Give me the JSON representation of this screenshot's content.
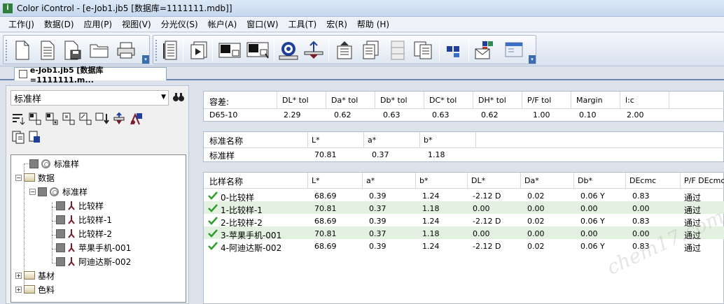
{
  "window": {
    "title": "Color iControl - [e-Job1.jb5 [数据库=1111111.mdb]]"
  },
  "menu": [
    "工作(J)",
    "数据(D)",
    "应用(P)",
    "视图(V)",
    "分光仪(S)",
    "帐户(A)",
    "窗口(W)",
    "工具(T)",
    "宏(R)",
    "帮助 (H)"
  ],
  "doc_tab": {
    "label": "e-Job1.jb5 [数据库=1111111.m..."
  },
  "left": {
    "combo_value": "标准样",
    "tree": {
      "std_root": "标准样",
      "data": "数据",
      "std_child": "标准样",
      "samples": [
        "比较样",
        "比较样-1",
        "比较样-2",
        "苹果手机-001",
        "阿迪达斯-002"
      ],
      "substrate": "基材",
      "colorant": "色料"
    }
  },
  "tolerance": {
    "headers": [
      "容差:",
      "DL* tol",
      "Da* tol",
      "Db* tol",
      "DC* tol",
      "DH* tol",
      "P/F tol",
      "Margin",
      "l:c"
    ],
    "row": [
      "D65-10",
      "2.29",
      "0.62",
      "0.63",
      "0.63",
      "0.62",
      "1.00",
      "0.10",
      "2.00"
    ]
  },
  "standard": {
    "headers": [
      "标准名称",
      "L*",
      "a*",
      "b*"
    ],
    "row": [
      "标准样",
      "70.81",
      "0.37",
      "1.18"
    ]
  },
  "samples": {
    "headers": [
      "比样名称",
      "L*",
      "a*",
      "b*",
      "DL*",
      "Da*",
      "Db*",
      "DEcmc",
      "P/F  DEcmc"
    ],
    "rows": [
      [
        "0-比较样",
        "68.69",
        "0.39",
        "1.24",
        "-2.12 D",
        "0.02",
        "0.06 Y",
        "0.83",
        "通过"
      ],
      [
        "1-比较样-1",
        "70.81",
        "0.37",
        "1.18",
        "0.00",
        "0.00",
        "0.00",
        "0.00",
        "通过"
      ],
      [
        "2-比较样-2",
        "68.69",
        "0.39",
        "1.24",
        "-2.12 D",
        "0.02",
        "0.06 Y",
        "0.83",
        "通过"
      ],
      [
        "3-苹果手机-001",
        "70.81",
        "0.37",
        "1.18",
        "0.00",
        "0.00",
        "0.00",
        "0.00",
        "通过"
      ],
      [
        "4-阿迪达斯-002",
        "68.69",
        "0.39",
        "1.24",
        "-2.12 D",
        "0.02",
        "0.06 Y",
        "0.83",
        "通过"
      ]
    ]
  },
  "watermark": "chem17.com",
  "colors": {
    "accent": "#3d6db1",
    "pass_green": "#e3f2e0",
    "check": "#2e9e2e"
  }
}
